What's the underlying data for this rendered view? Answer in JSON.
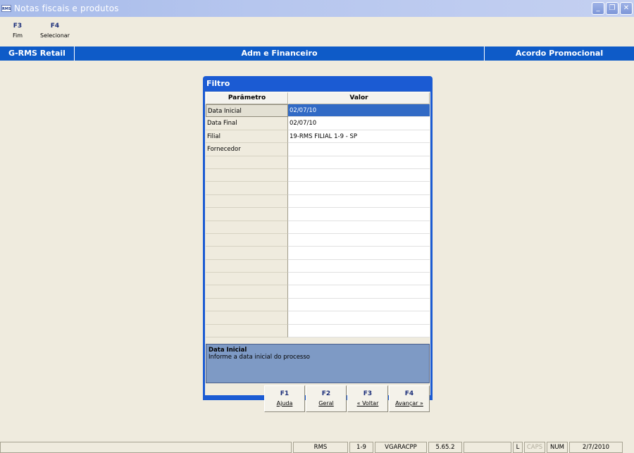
{
  "window": {
    "logo": "RMS",
    "title": "Notas fiscais e produtos",
    "buttons": {
      "minimize": "_",
      "restore": "❐",
      "close": "✕"
    }
  },
  "toolbar": [
    {
      "key": "F3",
      "label": "Fim"
    },
    {
      "key": "F4",
      "label": "Selecionar"
    }
  ],
  "header": {
    "left": "G-RMS Retail",
    "center": "Adm e Financeiro",
    "right": "Acordo Promocional"
  },
  "filter": {
    "title": "Filtro",
    "columns": {
      "param": "Parâmetro",
      "value": "Valor"
    },
    "rows": [
      {
        "param": "Data Inicial",
        "value": "02/07/10"
      },
      {
        "param": "Data Final",
        "value": "02/07/10"
      },
      {
        "param": "Filial",
        "value": "19-RMS FILIAL 1-9 - SP"
      },
      {
        "param": "Fornecedor",
        "value": ""
      }
    ],
    "description": {
      "title": "Data Inicial",
      "text": "Informe a data inicial do processo"
    },
    "buttons": [
      {
        "key": "F1",
        "label": "Ajuda"
      },
      {
        "key": "F2",
        "label": "Geral"
      },
      {
        "key": "F3",
        "label": "« Voltar"
      },
      {
        "key": "F4",
        "label": "Avançar »"
      }
    ]
  },
  "status": {
    "system": "RMS",
    "branch": "1-9",
    "user": "VGARACPP",
    "version": "5.65.2",
    "l": "L",
    "caps": "CAPS",
    "num": "NUM",
    "date": "2/7/2010"
  }
}
